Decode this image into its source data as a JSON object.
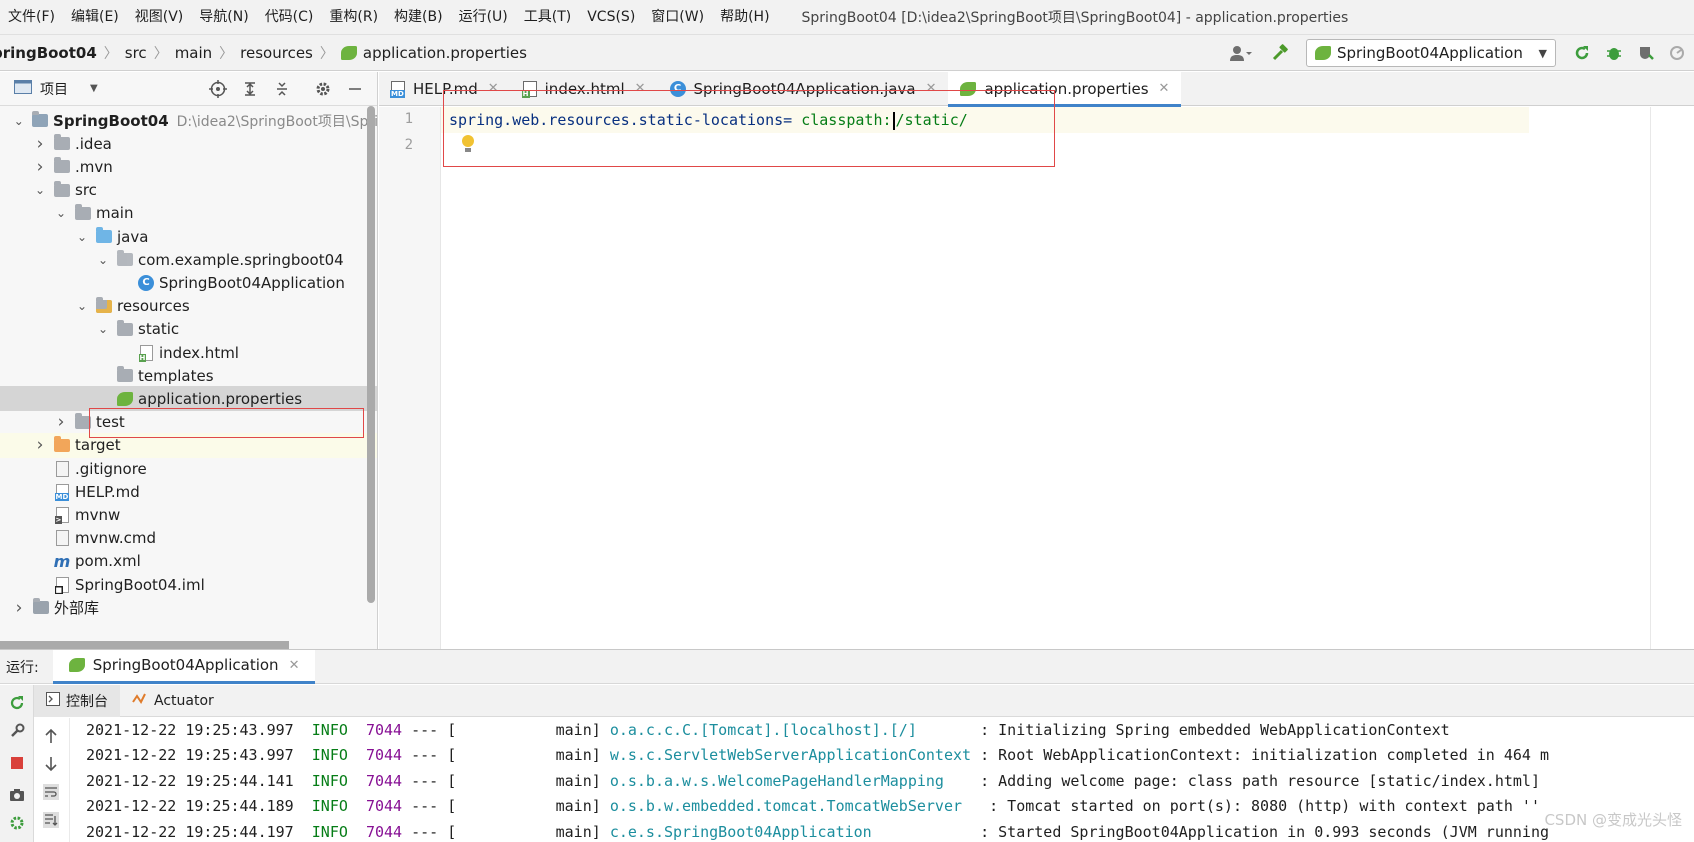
{
  "menu": {
    "items": [
      "文件(F)",
      "编辑(E)",
      "视图(V)",
      "导航(N)",
      "代码(C)",
      "重构(R)",
      "构建(B)",
      "运行(U)",
      "工具(T)",
      "VCS(S)",
      "窗口(W)",
      "帮助(H)"
    ],
    "window_title": "SpringBoot04 [D:\\idea2\\SpringBoot项目\\SpringBoot04] - application.properties"
  },
  "breadcrumb": [
    "pringBoot04",
    "src",
    "main",
    "resources",
    "application.properties"
  ],
  "run_config": {
    "label": "SpringBoot04Application"
  },
  "project_panel": {
    "title": "项目",
    "tree": [
      {
        "label": "SpringBoot04",
        "path": "D:\\idea2\\SpringBoot项目\\Spri",
        "level": 0,
        "expanded": "open",
        "icon": "module"
      },
      {
        "label": ".idea",
        "level": 1,
        "expanded": "closed",
        "icon": "folder"
      },
      {
        "label": ".mvn",
        "level": 1,
        "expanded": "closed",
        "icon": "folder"
      },
      {
        "label": "src",
        "level": 1,
        "expanded": "open",
        "icon": "folder"
      },
      {
        "label": "main",
        "level": 2,
        "expanded": "open",
        "icon": "folder"
      },
      {
        "label": "java",
        "level": 3,
        "expanded": "open",
        "icon": "folder-blue"
      },
      {
        "label": "com.example.springboot04",
        "level": 4,
        "expanded": "open",
        "icon": "package"
      },
      {
        "label": "SpringBoot04Application",
        "level": 5,
        "expanded": "none",
        "icon": "class"
      },
      {
        "label": "resources",
        "level": 3,
        "expanded": "open",
        "icon": "resources"
      },
      {
        "label": "static",
        "level": 4,
        "expanded": "open",
        "icon": "folder"
      },
      {
        "label": "index.html",
        "level": 5,
        "expanded": "none",
        "icon": "html"
      },
      {
        "label": "templates",
        "level": 4,
        "expanded": "none",
        "icon": "folder"
      },
      {
        "label": "application.properties",
        "level": 4,
        "expanded": "none",
        "icon": "spring",
        "state": "selected"
      },
      {
        "label": "test",
        "level": 2,
        "expanded": "closed",
        "icon": "folder"
      },
      {
        "label": "target",
        "level": 1,
        "expanded": "closed",
        "icon": "folder-orange",
        "state": "highlight"
      },
      {
        "label": ".gitignore",
        "level": 1,
        "expanded": "none",
        "icon": "file"
      },
      {
        "label": "HELP.md",
        "level": 1,
        "expanded": "none",
        "icon": "md"
      },
      {
        "label": "mvnw",
        "level": 1,
        "expanded": "none",
        "icon": "script"
      },
      {
        "label": "mvnw.cmd",
        "level": 1,
        "expanded": "none",
        "icon": "file"
      },
      {
        "label": "pom.xml",
        "level": 1,
        "expanded": "none",
        "icon": "maven"
      },
      {
        "label": "SpringBoot04.iml",
        "level": 1,
        "expanded": "none",
        "icon": "iml"
      },
      {
        "label": "外部库",
        "level": 0,
        "expanded": "closed",
        "icon": "library"
      }
    ]
  },
  "editor": {
    "tabs": [
      {
        "label": "HELP.md",
        "icon": "md"
      },
      {
        "label": "index.html",
        "icon": "html"
      },
      {
        "label": "SpringBoot04Application.java",
        "icon": "class"
      },
      {
        "label": "application.properties",
        "icon": "spring",
        "active": "true"
      }
    ],
    "line_numbers": [
      "1",
      "2"
    ],
    "code": {
      "key": "spring.web.resources.static-locations=",
      "value_before_caret": " classpath:",
      "value_after_caret": "/static/"
    }
  },
  "run_panel": {
    "label": "运行:",
    "tab": "SpringBoot04Application",
    "subtabs": [
      "控制台",
      "Actuator"
    ],
    "log": [
      {
        "ts": "2021-12-22 19:25:43.997",
        "level": "INFO",
        "pid": "7044",
        "mid": " --- [           main] ",
        "logger": "o.a.c.c.C.[Tomcat].[localhost].[/]      ",
        "msg": " : Initializing Spring embedded WebApplicationContext"
      },
      {
        "ts": "2021-12-22 19:25:43.997",
        "level": "INFO",
        "pid": "7044",
        "mid": " --- [           main] ",
        "logger": "w.s.c.ServletWebServerApplicationContext",
        "msg": " : Root WebApplicationContext: initialization completed in 464 m"
      },
      {
        "ts": "2021-12-22 19:25:44.141",
        "level": "INFO",
        "pid": "7044",
        "mid": " --- [           main] ",
        "logger": "o.s.b.a.w.s.WelcomePageHandlerMapping   ",
        "msg": " : Adding welcome page: class path resource [static/index.html]"
      },
      {
        "ts": "2021-12-22 19:25:44.189",
        "level": "INFO",
        "pid": "7044",
        "mid": " --- [           main] ",
        "logger": "o.s.b.w.embedded.tomcat.TomcatWebServer  ",
        "msg": " : Tomcat started on port(s): 8080 (http) with context path ''"
      },
      {
        "ts": "2021-12-22 19:25:44.197",
        "level": "INFO",
        "pid": "7044",
        "mid": " --- [           main] ",
        "logger": "c.e.s.SpringBoot04Application           ",
        "msg": " : Started SpringBoot04Application in 0.993 seconds (JVM running"
      }
    ],
    "watermark": "CSDN @变成光头怪"
  },
  "colors": {
    "accent": "#4083c9",
    "annotation": "#e04848",
    "info": "#067d17",
    "pid": "#871094",
    "logger": "#1c8e9e"
  }
}
